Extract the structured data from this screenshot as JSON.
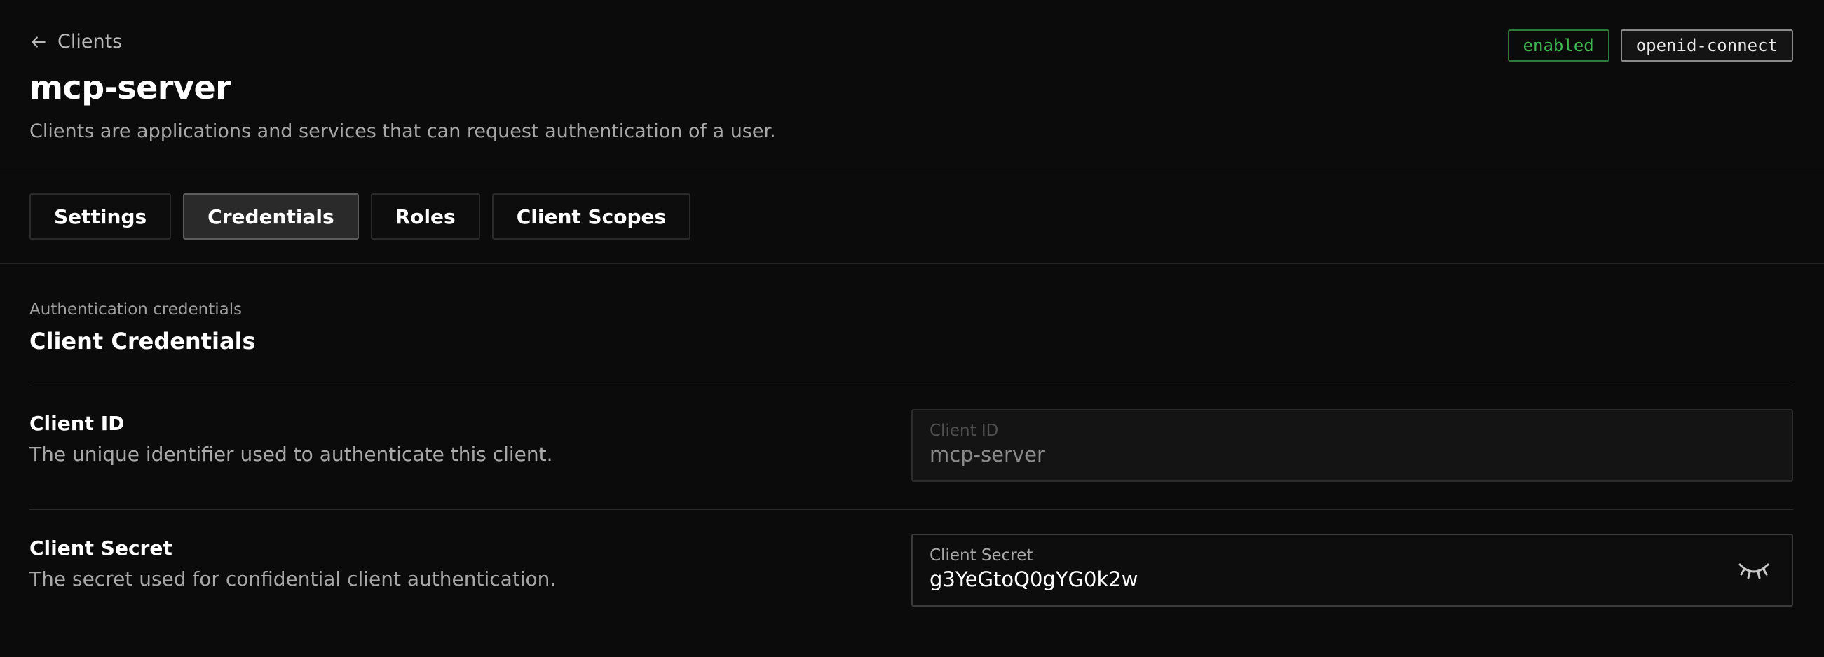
{
  "header": {
    "back_label": "Clients",
    "title": "mcp-server",
    "subtitle": "Clients are applications and services that can request authentication of a user.",
    "badges": {
      "status": "enabled",
      "protocol": "openid-connect"
    }
  },
  "tabs": [
    {
      "label": "Settings",
      "active": false
    },
    {
      "label": "Credentials",
      "active": true
    },
    {
      "label": "Roles",
      "active": false
    },
    {
      "label": "Client Scopes",
      "active": false
    }
  ],
  "section": {
    "eyebrow": "Authentication credentials",
    "title": "Client Credentials"
  },
  "fields": {
    "client_id": {
      "label": "Client ID",
      "description": "The unique identifier used to authenticate this client.",
      "input_label": "Client ID",
      "value": "mcp-server"
    },
    "client_secret": {
      "label": "Client Secret",
      "description": "The secret used for confidential client authentication.",
      "input_label": "Client Secret",
      "value": "g3YeGtoQ0gYG0k2w",
      "toggle_icon": "eye-closed-icon"
    }
  },
  "colors": {
    "background": "#0b0b0b",
    "status_green": "#3fb950",
    "active_tab": "#2a2a2a"
  }
}
